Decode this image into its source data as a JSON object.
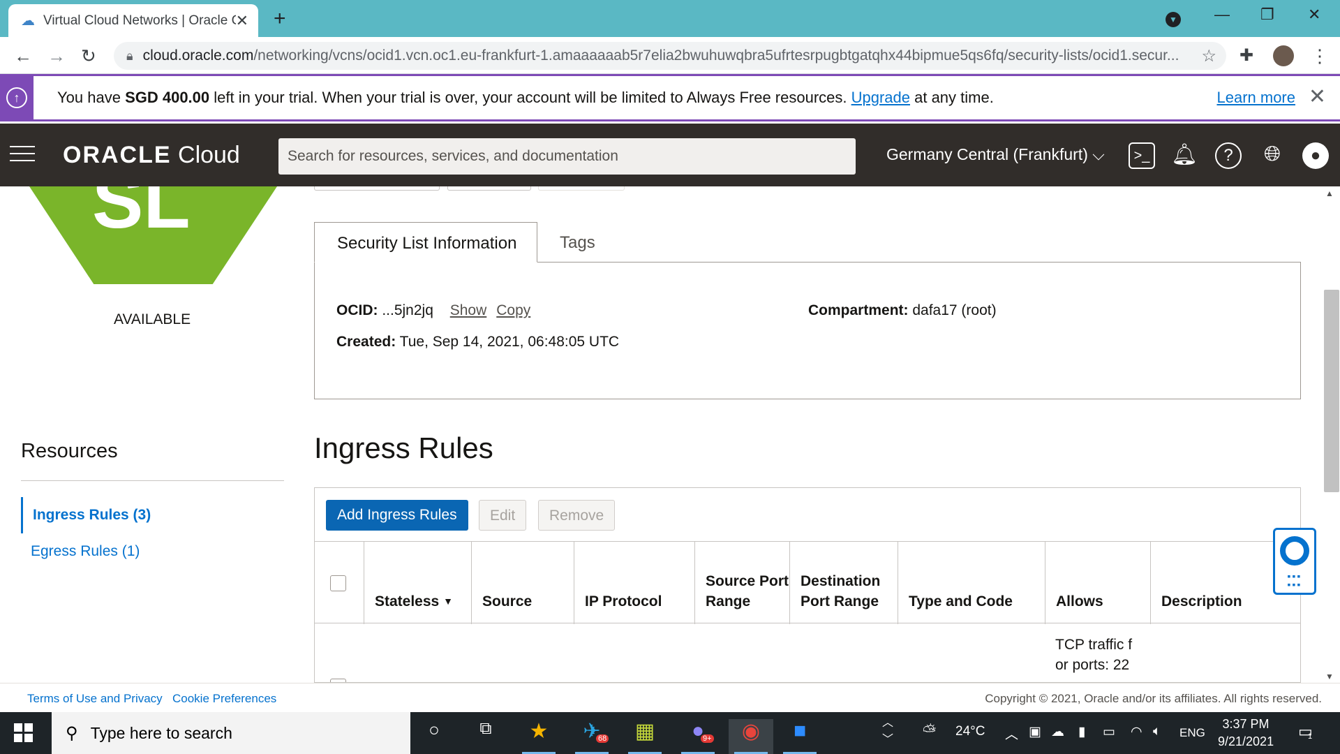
{
  "browser": {
    "tab_title": "Virtual Cloud Networks | Oracle C",
    "url_host": "cloud.oracle.com",
    "url_path": "/networking/vcns/ocid1.vcn.oc1.eu-frankfurt-1.amaaaaaab5r7elia2bwuhuwqbra5ufrtesrpugbtgatqhx44bipmue5qs6fq/security-lists/ocid1.secur..."
  },
  "banner": {
    "prefix": "You have ",
    "amount": "SGD 400.00",
    "middle": " left in your trial. When your trial is over, your account will be limited to Always Free resources. ",
    "upgrade": "Upgrade",
    "suffix": " at any time.",
    "learn_more": "Learn more"
  },
  "header": {
    "logo_brand": "ORACLE",
    "logo_product": " Cloud",
    "search_placeholder": "Search for resources, services, and documentation",
    "region": "Germany Central (Frankfurt)"
  },
  "left": {
    "status": "AVAILABLE",
    "resources_title": "Resources",
    "items": [
      {
        "label": "Ingress Rules (3)",
        "active": true
      },
      {
        "label": "Egress Rules (1)",
        "active": false
      }
    ]
  },
  "tabs": [
    "Security List Information",
    "Tags"
  ],
  "info": {
    "ocid_label": "OCID:",
    "ocid_value": " ...5jn2jq",
    "show": "Show",
    "copy": "Copy",
    "compartment_label": "Compartment:",
    "compartment_value": " dafa17 (root)",
    "created_label": "Created:",
    "created_value": " Tue, Sep 14, 2021, 06:48:05 UTC"
  },
  "ingress": {
    "title": "Ingress Rules",
    "add_button": "Add Ingress Rules",
    "edit_button": "Edit",
    "remove_button": "Remove",
    "columns": [
      "Stateless",
      "Source",
      "IP Protocol",
      "Source Port Range",
      "Destination Port Range",
      "Type and Code",
      "Allows",
      "Description"
    ],
    "first_row_allows": [
      "TCP traffic f",
      "or ports: 22"
    ]
  },
  "footer": {
    "terms": "Terms of Use and Privacy",
    "cookies": "Cookie Preferences",
    "copyright": "Copyright © 2021, Oracle and/or its affiliates. All rights reserved."
  },
  "taskbar": {
    "search_placeholder": "Type here to search",
    "telegram_badge": "68",
    "discord_badge": "9+",
    "weather": "24°C",
    "language": "ENG",
    "time": "3:37 PM",
    "date": "9/21/2021",
    "notification_count": "1"
  },
  "colors": {
    "brand_purple": "#7d4ab6",
    "oracle_header": "#312d2a",
    "primary_button": "#0a66b3",
    "status_green": "#7ab52a",
    "link_blue": "#0572ce"
  }
}
